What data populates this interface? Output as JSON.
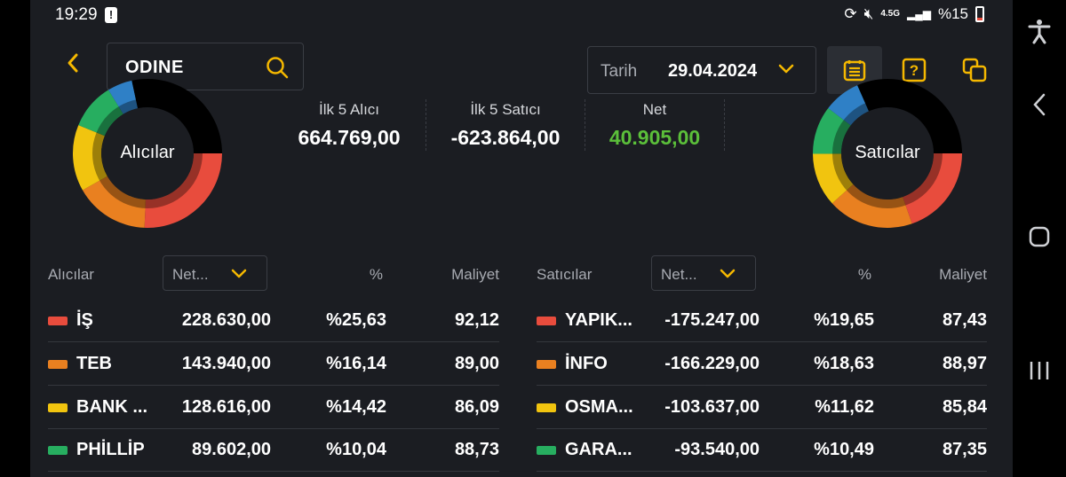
{
  "status": {
    "time": "19:29",
    "network": "4.5G",
    "battery": "%15"
  },
  "search": {
    "value": "ODINE"
  },
  "date": {
    "label": "Tarih",
    "value": "29.04.2024"
  },
  "summary": {
    "buyers_label": "İlk 5 Alıcı",
    "buyers_value": "664.769,00",
    "sellers_label": "İlk 5 Satıcı",
    "sellers_value": "-623.864,00",
    "net_label": "Net",
    "net_value": "40.905,00"
  },
  "colors": {
    "red": "#e84c3d",
    "orange": "#e98020",
    "yellow": "#f1c40f",
    "green": "#27ae60",
    "blue": "#2f80c6",
    "black": "#000000",
    "accent": "#f5b800",
    "positive": "#5bbf3a"
  },
  "donuts": {
    "buyers": {
      "label": "Alıcılar",
      "slices": [
        {
          "name": "İŞ",
          "pct": 25.63,
          "color": "#e84c3d"
        },
        {
          "name": "TEB",
          "pct": 16.14,
          "color": "#e98020"
        },
        {
          "name": "BANK ...",
          "pct": 14.42,
          "color": "#f1c40f"
        },
        {
          "name": "PHİLLİP",
          "pct": 10.04,
          "color": "#27ae60"
        },
        {
          "name": "other",
          "pct": 5.4,
          "color": "#2f80c6"
        },
        {
          "name": "rest",
          "pct": 28.37,
          "color": "#000000"
        }
      ]
    },
    "sellers": {
      "label": "Satıcılar",
      "slices": [
        {
          "name": "YAPIK...",
          "pct": 19.65,
          "color": "#e84c3d"
        },
        {
          "name": "İNFO",
          "pct": 18.63,
          "color": "#e98020"
        },
        {
          "name": "OSMA...",
          "pct": 11.62,
          "color": "#f1c40f"
        },
        {
          "name": "GARA...",
          "pct": 10.49,
          "color": "#27ae60"
        },
        {
          "name": "other",
          "pct": 8.0,
          "color": "#2f80c6"
        },
        {
          "name": "rest",
          "pct": 31.61,
          "color": "#000000"
        }
      ]
    }
  },
  "buyers_table": {
    "title": "Alıcılar",
    "dropdown": "Net...",
    "pct_header": "%",
    "cost_header": "Maliyet",
    "rows": [
      {
        "name": "İŞ",
        "net": "228.630,00",
        "pct": "%25,63",
        "cost": "92,12",
        "color": "#e84c3d"
      },
      {
        "name": "TEB",
        "net": "143.940,00",
        "pct": "%16,14",
        "cost": "89,00",
        "color": "#e98020"
      },
      {
        "name": "BANK ...",
        "net": "128.616,00",
        "pct": "%14,42",
        "cost": "86,09",
        "color": "#f1c40f"
      },
      {
        "name": "PHİLLİP",
        "net": "89.602,00",
        "pct": "%10,04",
        "cost": "88,73",
        "color": "#27ae60"
      }
    ]
  },
  "sellers_table": {
    "title": "Satıcılar",
    "dropdown": "Net...",
    "pct_header": "%",
    "cost_header": "Maliyet",
    "rows": [
      {
        "name": "YAPIK...",
        "net": "-175.247,00",
        "pct": "%19,65",
        "cost": "87,43",
        "color": "#e84c3d"
      },
      {
        "name": "İNFO",
        "net": "-166.229,00",
        "pct": "%18,63",
        "cost": "88,97",
        "color": "#e98020"
      },
      {
        "name": "OSMA...",
        "net": "-103.637,00",
        "pct": "%11,62",
        "cost": "85,84",
        "color": "#f1c40f"
      },
      {
        "name": "GARA...",
        "net": "-93.540,00",
        "pct": "%10,49",
        "cost": "87,35",
        "color": "#27ae60"
      }
    ]
  }
}
